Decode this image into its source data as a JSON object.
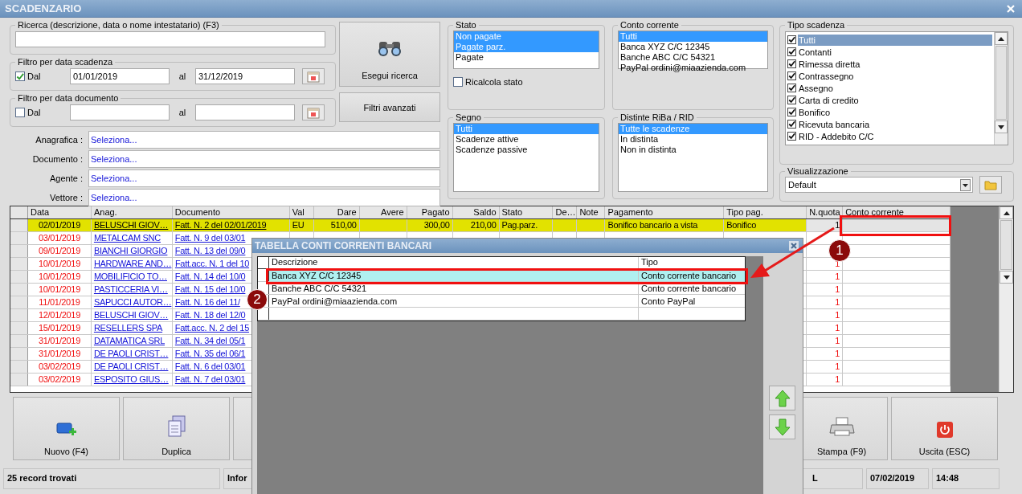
{
  "window": {
    "title": "SCADENZARIO"
  },
  "search": {
    "title": "Ricerca (descrizione, data o nome intestatario) (F3)"
  },
  "due_date_filter": {
    "title": "Filtro per data scadenza",
    "checkbox_label": "Dal",
    "checked": true,
    "from": "01/01/2019",
    "to_label": "al",
    "to": "31/12/2019"
  },
  "document_date_filter": {
    "title": "Filtro per data documento",
    "checkbox_label": "Dal",
    "checked": false,
    "to_label": "al"
  },
  "search_button": {
    "label": "Esegui ricerca"
  },
  "advanced_button": {
    "label": "Filtri avanzati"
  },
  "lookups": [
    {
      "label": "Anagrafica :",
      "value": "Seleziona..."
    },
    {
      "label": "Documento :",
      "value": "Seleziona..."
    },
    {
      "label": "Agente :",
      "value": "Seleziona..."
    },
    {
      "label": "Vettore :",
      "value": "Seleziona..."
    }
  ],
  "stato": {
    "title": "Stato",
    "items": [
      {
        "label": "Non pagate",
        "selected": true
      },
      {
        "label": "Pagate parz.",
        "selected": true
      },
      {
        "label": "Pagate",
        "selected": false
      }
    ],
    "recalc": {
      "label": "Ricalcola stato",
      "checked": false
    }
  },
  "conto_corrente": {
    "title": "Conto corrente",
    "items": [
      {
        "label": "Tutti",
        "selected": true
      },
      {
        "label": "Banca XYZ C/C 12345",
        "selected": false
      },
      {
        "label": "Banche ABC C/C 54321",
        "selected": false
      },
      {
        "label": "PayPal ordini@miaazienda.com",
        "selected": false
      }
    ]
  },
  "segno": {
    "title": "Segno",
    "items": [
      {
        "label": "Tutti",
        "selected": true
      },
      {
        "label": "Scadenze attive",
        "selected": false
      },
      {
        "label": "Scadenze passive",
        "selected": false
      }
    ]
  },
  "distinte": {
    "title": "Distinte RiBa / RID",
    "items": [
      {
        "label": "Tutte le scadenze",
        "selected": true
      },
      {
        "label": "In distinta",
        "selected": false
      },
      {
        "label": "Non in distinta",
        "selected": false
      }
    ]
  },
  "tipo_scadenza": {
    "title": "Tipo scadenza",
    "items": [
      {
        "label": "Tutti",
        "checked": true,
        "selected": true
      },
      {
        "label": "Contanti",
        "checked": true,
        "selected": false
      },
      {
        "label": "Rimessa diretta",
        "checked": true,
        "selected": false
      },
      {
        "label": "Contrassegno",
        "checked": true,
        "selected": false
      },
      {
        "label": "Assegno",
        "checked": true,
        "selected": false
      },
      {
        "label": "Carta di credito",
        "checked": true,
        "selected": false
      },
      {
        "label": "Bonifico",
        "checked": true,
        "selected": false
      },
      {
        "label": "Ricevuta bancaria",
        "checked": true,
        "selected": false
      },
      {
        "label": "RID - Addebito C/C",
        "checked": true,
        "selected": false
      }
    ]
  },
  "visualizzazione": {
    "title": "Visualizzazione",
    "value": "Default"
  },
  "table": {
    "columns": [
      "Data",
      "Anag.",
      "Documento",
      "Val",
      "Dare",
      "Avere",
      "Pagato",
      "Saldo",
      "Stato",
      "De…",
      "Note",
      "Pagamento",
      "Tipo pag.",
      "N.quota",
      "Conto corrente"
    ],
    "rows": [
      {
        "date": "02/01/2019",
        "anag": "BELUSCHI GIOV…",
        "documento": "Fatt. N. 2 del 02/01/2019",
        "val": "EU",
        "dare": "510,00",
        "pagato": "300,00",
        "saldo": "210,00",
        "stato": "Pag.parz.",
        "pagamento": "Bonifico bancario a vista",
        "tipo_pag": "Bonifico",
        "n_quota": "1",
        "selected": true,
        "overdue": false
      },
      {
        "date": "03/01/2019",
        "anag": "METALCAM SNC",
        "documento": "Fatt. N. 9 del 03/01",
        "selected": false,
        "overdue": true
      },
      {
        "date": "09/01/2019",
        "anag": "BIANCHI GIORGIO",
        "documento": "Fatt. N. 13 del 09/0",
        "selected": false,
        "overdue": true
      },
      {
        "date": "10/01/2019",
        "anag": "HARDWARE AND…",
        "documento": "Fatt.acc. N. 1 del 10",
        "n_quota": "1",
        "selected": false,
        "overdue": true
      },
      {
        "date": "10/01/2019",
        "anag": "MOBILIFICIO TO…",
        "documento": "Fatt. N. 14 del 10/0",
        "n_quota": "1",
        "selected": false,
        "overdue": true
      },
      {
        "date": "10/01/2019",
        "anag": "PASTICCERIA VI…",
        "documento": "Fatt. N. 15 del 10/0",
        "n_quota": "1",
        "selected": false,
        "overdue": true
      },
      {
        "date": "11/01/2019",
        "anag": "SAPUCCI AUTOR…",
        "documento": "Fatt. N. 16 del 11/",
        "n_quota": "1",
        "selected": false,
        "overdue": true
      },
      {
        "date": "12/01/2019",
        "anag": "BELUSCHI GIOV…",
        "documento": "Fatt. N. 18 del 12/0",
        "n_quota": "1",
        "selected": false,
        "overdue": true
      },
      {
        "date": "15/01/2019",
        "anag": "RESELLERS SPA",
        "documento": "Fatt.acc. N. 2 del 15",
        "n_quota": "1",
        "selected": false,
        "overdue": true
      },
      {
        "date": "31/01/2019",
        "anag": "DATAMATICA SRL",
        "documento": "Fatt. N. 34 del 05/1",
        "n_quota": "1",
        "selected": false,
        "overdue": true
      },
      {
        "date": "31/01/2019",
        "anag": "DE PAOLI CRIST…",
        "documento": "Fatt. N. 35 del 06/1",
        "n_quota": "1",
        "selected": false,
        "overdue": true
      },
      {
        "date": "03/02/2019",
        "anag": "DE PAOLI CRIST…",
        "documento": "Fatt. N. 6 del 03/01",
        "n_quota": "1",
        "selected": false,
        "overdue": true
      },
      {
        "date": "03/02/2019",
        "anag": "ESPOSITO GIUS…",
        "documento": "Fatt. N. 7 del 03/01",
        "n_quota": "1",
        "selected": false,
        "overdue": true
      }
    ]
  },
  "toolbar_left": [
    {
      "kind": "new",
      "label": "Nuovo (F4)"
    },
    {
      "kind": "duplicate",
      "label": "Duplica"
    },
    {
      "kind": "hidden"
    }
  ],
  "toolbar_right": [
    {
      "kind": "print",
      "label": "Stampa (F9)"
    },
    {
      "kind": "exit",
      "label": "Uscita (ESC)"
    }
  ],
  "status_bar": {
    "records": "25 record trovati",
    "info": "Infor",
    "cell_3": "L",
    "date": "07/02/2019",
    "time": "14:48"
  },
  "popup": {
    "title": "TABELLA CONTI CORRENTI BANCARI",
    "columns": [
      "Descrizione",
      "Tipo"
    ],
    "rows": [
      {
        "descrizione": "Banca XYZ C/C 12345",
        "tipo": "Conto corrente bancario",
        "selected": true
      },
      {
        "descrizione": "Banche ABC C/C 54321",
        "tipo": "Conto corrente bancario",
        "selected": false
      },
      {
        "descrizione": "PayPal ordini@miaazienda.com",
        "tipo": "Conto PayPal",
        "selected": false
      }
    ]
  },
  "callouts": [
    {
      "number": "1"
    },
    {
      "number": "2"
    }
  ]
}
